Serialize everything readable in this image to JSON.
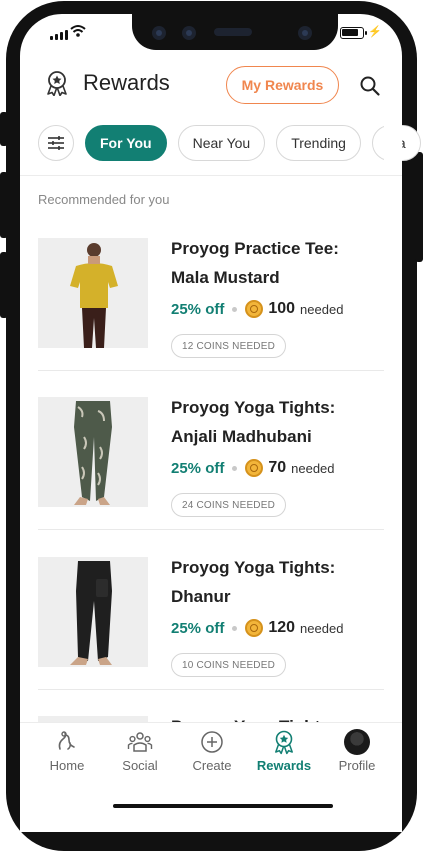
{
  "header": {
    "title": "Rewards",
    "my_rewards_label": "My Rewards"
  },
  "chips": [
    "For You",
    "Near You",
    "Trending",
    "Ga"
  ],
  "section_title": "Recommended for you",
  "products": [
    {
      "title": "Proyog Practice Tee: Mala Mustard",
      "discount": "25% off",
      "coins": "100",
      "needed": "needed",
      "badge": "12 COINS NEEDED"
    },
    {
      "title": "Proyog Yoga Tights: Anjali Madhubani",
      "discount": "25% off",
      "coins": "70",
      "needed": "needed",
      "badge": "24 COINS NEEDED"
    },
    {
      "title": "Proyog Yoga Tights: Dhanur",
      "discount": "25% off",
      "coins": "120",
      "needed": "needed",
      "badge": "10 COINS NEEDED"
    },
    {
      "title": "Proyog Yoga Tights:"
    }
  ],
  "tabs": [
    {
      "label": "Home",
      "icon": "home-icon"
    },
    {
      "label": "Social",
      "icon": "social-icon"
    },
    {
      "label": "Create",
      "icon": "create-icon"
    },
    {
      "label": "Rewards",
      "icon": "rewards-icon",
      "active": true
    },
    {
      "label": "Profile",
      "icon": "avatar"
    }
  ],
  "colors": {
    "accent": "#127f73",
    "brand_orange": "#f0864e",
    "coin": "#f2b53a"
  }
}
